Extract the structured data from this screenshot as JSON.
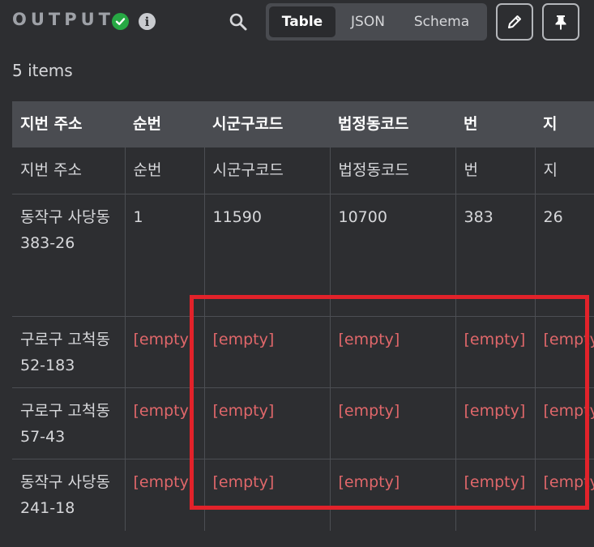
{
  "header": {
    "title": "OUTPUT",
    "status_icon": "check-circle-icon",
    "info_glyph": "i",
    "tabs": [
      {
        "label": "Table",
        "active": true
      },
      {
        "label": "JSON",
        "active": false
      },
      {
        "label": "Schema",
        "active": false
      }
    ]
  },
  "summary": {
    "count_text": "5 items"
  },
  "table": {
    "columns": [
      "지번 주소",
      "순번",
      "시군구코드",
      "법정동코드",
      "번",
      "지"
    ],
    "rows": [
      [
        "지번 주소",
        "순번",
        "시군구코드",
        "법정동코드",
        "번",
        "지"
      ],
      [
        "동작구 사당동 383-26",
        "1",
        "11590",
        "10700",
        "383",
        "26"
      ],
      [
        "구로구 고척동 52-183",
        "[empty]",
        "[empty]",
        "[empty]",
        "[empty]",
        "[empty]"
      ],
      [
        "구로구 고척동 57-43",
        "[empty]",
        "[empty]",
        "[empty]",
        "[empty]",
        "[empty]"
      ],
      [
        "동작구 사당동 241-18",
        "[empty]",
        "[empty]",
        "[empty]",
        "[empty]",
        "[empty]"
      ]
    ]
  },
  "colors": {
    "background": "#2d2e31",
    "header_row": "#4a4c51",
    "empty_text": "#e0676a",
    "success": "#27a844",
    "highlight_box": "#e2222a"
  }
}
